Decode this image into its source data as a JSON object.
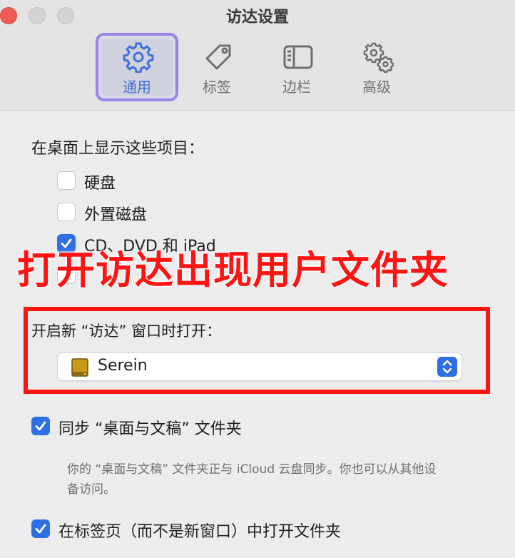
{
  "window": {
    "title": "访达设置"
  },
  "toolbar": {
    "tabs": [
      {
        "label": "通用",
        "icon": "gear-icon",
        "selected": true
      },
      {
        "label": "标签",
        "icon": "tag-icon",
        "selected": false
      },
      {
        "label": "边栏",
        "icon": "sidebar-icon",
        "selected": false
      },
      {
        "label": "高级",
        "icon": "gears-icon",
        "selected": false
      }
    ]
  },
  "desktop_items": {
    "heading": "在桌面上显示这些项目：",
    "options": [
      {
        "label": "硬盘",
        "checked": false
      },
      {
        "label": "外置磁盘",
        "checked": false
      },
      {
        "label": "CD、DVD 和 iPad",
        "checked": true
      }
    ]
  },
  "annotation": {
    "text": "打开访达出现用户文件夹",
    "color": "#ff1414"
  },
  "new_window": {
    "label": "开启新 “访达” 窗口时打开：",
    "selected_value": "Serein",
    "selected_icon": "external-drive-icon"
  },
  "sync": {
    "label": "同步 “桌面与文稿” 文件夹",
    "checked": true,
    "note": "你的 “桌面与文稿” 文件夹正与 iCloud 云盘同步。你也可以从其他设备访问。"
  },
  "tabs_option": {
    "label": "在标签页（而不是新窗口）中打开文件夹",
    "checked": true
  },
  "colors": {
    "accent": "#2f6fe4",
    "selected_tab_border": "#9a84e6",
    "close_button": "#ee5c55"
  }
}
